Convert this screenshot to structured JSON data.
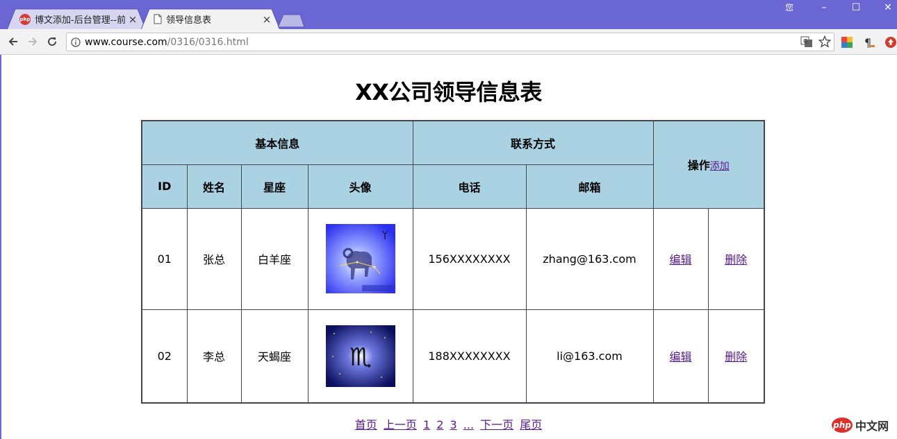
{
  "browser": {
    "user_label": "您",
    "tabs": [
      {
        "title": "博文添加-后台管理--前台",
        "favicon": "php-icon",
        "active": false
      },
      {
        "title": "领导信息表",
        "favicon": "page-icon",
        "active": true
      }
    ],
    "close_glyph": "×",
    "window": {
      "minimize": "–",
      "maximize": "☐",
      "close": "✕"
    },
    "address": {
      "host": "www.course.com",
      "path": "/0316/0316.html"
    }
  },
  "page": {
    "title": "XX公司领导信息表",
    "table": {
      "group_headers": {
        "basic": "基本信息",
        "contact": "联系方式",
        "action": "操作",
        "add_link": "添加"
      },
      "columns": [
        "ID",
        "姓名",
        "星座",
        "头像",
        "电话",
        "邮箱"
      ],
      "rows": [
        {
          "id": "01",
          "name": "张总",
          "sign": "白羊座",
          "avatar": "aries-icon",
          "phone": "156XXXXXXXX",
          "email": "zhang@163.com",
          "edit": "编辑",
          "delete": "删除"
        },
        {
          "id": "02",
          "name": "李总",
          "sign": "天蝎座",
          "avatar": "scorpio-icon",
          "phone": "188XXXXXXXX",
          "email": "li@163.com",
          "edit": "编辑",
          "delete": "删除"
        }
      ]
    },
    "pager": {
      "first": "首页",
      "prev": "上一页",
      "pages": [
        "1",
        "2",
        "3",
        "..."
      ],
      "next": "下一页",
      "last": "尾页"
    },
    "brand": {
      "badge": "php",
      "text": "中文网"
    }
  },
  "colors": {
    "titlebar": "#6a66d4",
    "header_bg": "#abd2e3",
    "link": "#551a8b"
  }
}
